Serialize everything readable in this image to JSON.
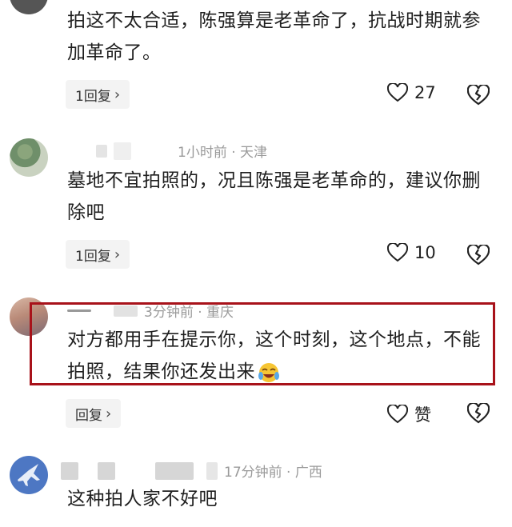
{
  "comments": [
    {
      "text": "拍这不太合适，陈强算是老革命了，抗战时期就参加革命了。",
      "reply_label": "1回复",
      "like_count": "27"
    },
    {
      "meta": "1小时前 · 天津",
      "text": "墓地不宜拍照的，况且陈强是老革命的，建议你删除吧",
      "reply_label": "1回复",
      "like_count": "10"
    },
    {
      "meta": "3分钟前 · 重庆",
      "text": "对方都用手在提示你，这个时刻，这个地点，不能拍照，结果你还发出来",
      "reply_label": "回复",
      "like_count": "赞"
    },
    {
      "meta": "17分钟前 · 广西",
      "text": "这种拍人家不好吧"
    }
  ],
  "colors": {
    "highlight": "#a8121a",
    "meta": "#9a9a9a"
  },
  "icons": [
    "heart-icon",
    "broken-heart-icon",
    "chevron-right-icon",
    "laughing-emoji-icon"
  ]
}
